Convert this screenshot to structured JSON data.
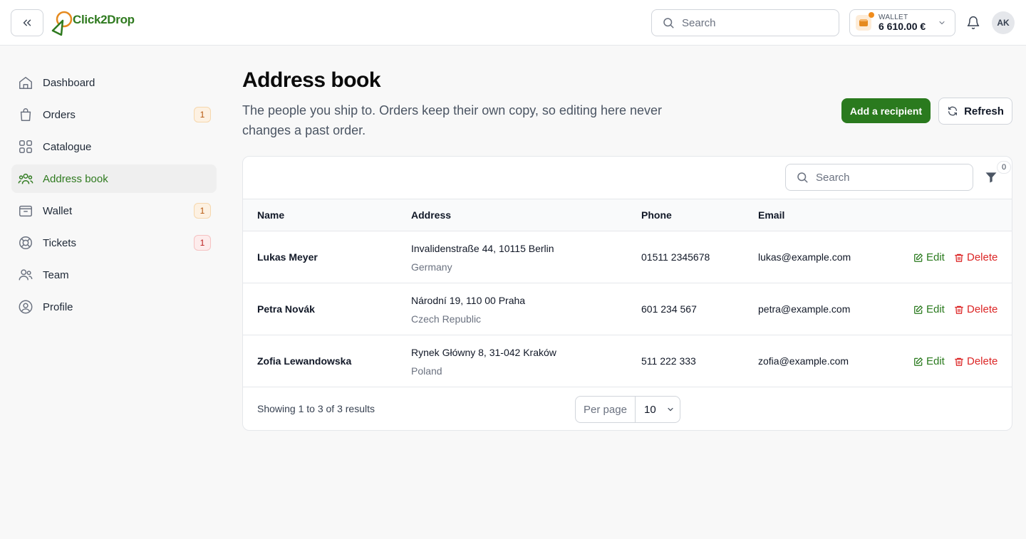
{
  "app": {
    "logo_text": "Click2Drop"
  },
  "header": {
    "search_placeholder": "Search",
    "wallet_label": "WALLET",
    "wallet_amount": "6 610.00 €",
    "avatar_initials": "AK"
  },
  "sidebar": {
    "items": [
      {
        "label": "Dashboard",
        "icon": "home-icon",
        "badge": ""
      },
      {
        "label": "Orders",
        "icon": "shopping-bag-icon",
        "badge": "1"
      },
      {
        "label": "Catalogue",
        "icon": "grid-icon",
        "badge": ""
      },
      {
        "label": "Address book",
        "icon": "users-group-icon",
        "badge": ""
      },
      {
        "label": "Wallet",
        "icon": "wallet-icon",
        "badge": "1"
      },
      {
        "label": "Tickets",
        "icon": "lifebuoy-icon",
        "badge": "1"
      },
      {
        "label": "Team",
        "icon": "team-icon",
        "badge": ""
      },
      {
        "label": "Profile",
        "icon": "user-circle-icon",
        "badge": ""
      }
    ]
  },
  "page": {
    "title": "Address book",
    "subtitle": "The people you ship to. Orders keep their own copy, so editing here never changes a past order.",
    "add_button": "Add a recipient",
    "refresh_button": "Refresh"
  },
  "table": {
    "search_placeholder": "Search",
    "filter_count": "0",
    "columns": [
      "Name",
      "Address",
      "Phone",
      "Email"
    ],
    "rows": [
      {
        "name": "Lukas Meyer",
        "address_line": "Invalidenstraße 44, 10115 Berlin",
        "country": "Germany",
        "phone": "01511 2345678",
        "email": "lukas@example.com"
      },
      {
        "name": "Petra Novák",
        "address_line": "Národní 19, 110 00 Praha",
        "country": "Czech Republic",
        "phone": "601 234 567",
        "email": "petra@example.com"
      },
      {
        "name": "Zofia Lewandowska",
        "address_line": "Rynek Główny 8, 31-042 Kraków",
        "country": "Poland",
        "phone": "511 222 333",
        "email": "zofia@example.com"
      }
    ],
    "edit_label": "Edit",
    "delete_label": "Delete",
    "footer_info": "Showing 1 to 3 of 3 results",
    "per_page_label": "Per page",
    "per_page_value": "10"
  },
  "colors": {
    "brand_green": "#2a7a1e",
    "danger_red": "#dc2626",
    "accent_orange": "#f08c1c"
  }
}
